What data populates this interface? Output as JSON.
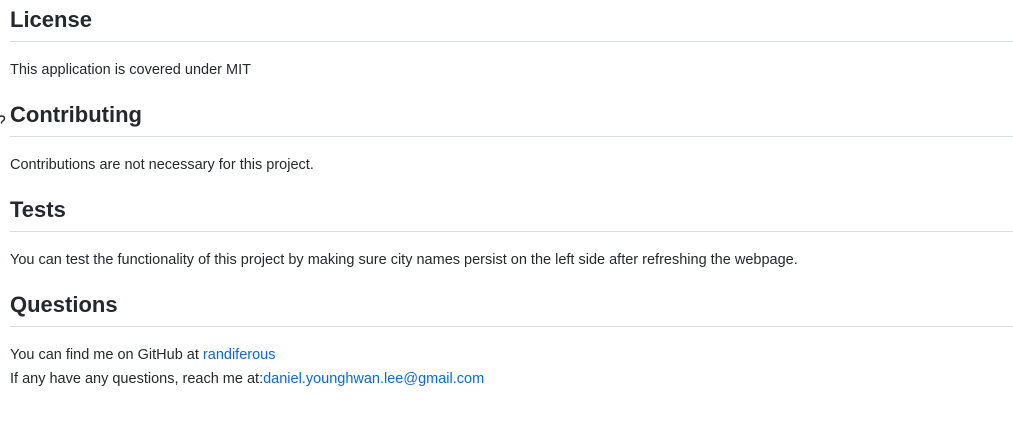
{
  "license": {
    "heading": "License",
    "text": "This application is covered under MIT"
  },
  "contributing": {
    "heading": "Contributing",
    "text": "Contributions are not necessary for this project."
  },
  "tests": {
    "heading": "Tests",
    "text": "You can test the functionality of this project by making sure city names persist on the left side after refreshing the webpage."
  },
  "questions": {
    "heading": "Questions",
    "github_prefix": "You can find me on GitHub at ",
    "github_link": "randiferous",
    "email_prefix": "If any have any questions, reach me at:",
    "email_link": "daniel.younghwan.lee@gmail.com"
  },
  "colors": {
    "link": "#0969da",
    "text": "#24292f",
    "divider": "#d8dee4"
  },
  "icons": {
    "heading_anchor": "link-icon"
  }
}
